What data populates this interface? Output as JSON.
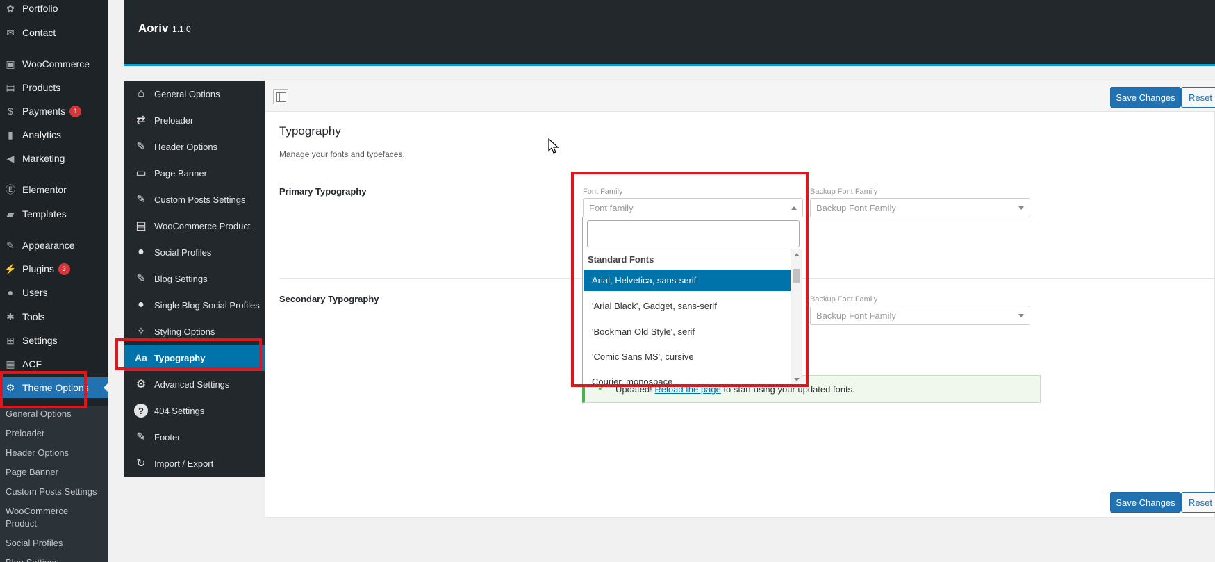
{
  "sidebar": {
    "items": [
      {
        "label": "Portfolio",
        "icon": "portfolio-icon",
        "glyph": "✿"
      },
      {
        "label": "Contact",
        "icon": "mail-icon",
        "glyph": "✉"
      },
      {
        "label": "WooCommerce",
        "icon": "woocommerce-icon",
        "glyph": "▣"
      },
      {
        "label": "Products",
        "icon": "products-icon",
        "glyph": "▤"
      },
      {
        "label": "Payments",
        "icon": "payments-icon",
        "glyph": "$",
        "badge": "1"
      },
      {
        "label": "Analytics",
        "icon": "analytics-icon",
        "glyph": "▮"
      },
      {
        "label": "Marketing",
        "icon": "megaphone-icon",
        "glyph": "◀"
      },
      {
        "label": "Elementor",
        "icon": "elementor-icon",
        "glyph": "Ⓔ"
      },
      {
        "label": "Templates",
        "icon": "folder-icon",
        "glyph": "▰"
      },
      {
        "label": "Appearance",
        "icon": "brush-icon",
        "glyph": "✎"
      },
      {
        "label": "Plugins",
        "icon": "plugin-icon",
        "glyph": "⚡",
        "badge": "3"
      },
      {
        "label": "Users",
        "icon": "user-icon",
        "glyph": "●"
      },
      {
        "label": "Tools",
        "icon": "wrench-icon",
        "glyph": "✱"
      },
      {
        "label": "Settings",
        "icon": "settings-icon",
        "glyph": "⊞"
      },
      {
        "label": "ACF",
        "icon": "acf-icon",
        "glyph": "▦"
      },
      {
        "label": "Theme Options",
        "icon": "gear-icon",
        "glyph": "⚙"
      }
    ],
    "submenu": [
      "General Options",
      "Preloader",
      "Header Options",
      "Page Banner",
      "Custom Posts Settings",
      "WooCommerce Product",
      "Social Profiles",
      "Blog Settings"
    ]
  },
  "header": {
    "title": "Aoriv",
    "version": "1.1.0"
  },
  "nav": {
    "items": [
      {
        "label": "General Options",
        "icon": "home-icon",
        "glyph": "⌂"
      },
      {
        "label": "Preloader",
        "icon": "repeat-icon",
        "glyph": "⇄"
      },
      {
        "label": "Header Options",
        "icon": "edit-icon",
        "glyph": "✎"
      },
      {
        "label": "Page Banner",
        "icon": "banner-icon",
        "glyph": "▭"
      },
      {
        "label": "Custom Posts Settings",
        "icon": "edit-icon",
        "glyph": "✎"
      },
      {
        "label": "WooCommerce Product",
        "icon": "clipboard-icon",
        "glyph": "▤"
      },
      {
        "label": "Social Profiles",
        "icon": "user-icon",
        "glyph": "●"
      },
      {
        "label": "Blog Settings",
        "icon": "edit-icon",
        "glyph": "✎"
      },
      {
        "label": "Single Blog Social Profiles",
        "icon": "user-icon",
        "glyph": "●"
      },
      {
        "label": "Styling Options",
        "icon": "magic-wand-icon",
        "glyph": "✧"
      },
      {
        "label": "Typography",
        "icon": "typography-icon",
        "glyph": "Aa"
      },
      {
        "label": "Advanced Settings",
        "icon": "cogs-icon",
        "glyph": "⚙"
      },
      {
        "label": "404 Settings",
        "icon": "question-icon",
        "glyph": "?"
      },
      {
        "label": "Footer",
        "icon": "edit-icon",
        "glyph": "✎"
      },
      {
        "label": "Import / Export",
        "icon": "refresh-icon",
        "glyph": "↻"
      }
    ]
  },
  "toolbar": {
    "save_label": "Save Changes",
    "reset_label": "Reset Section"
  },
  "section": {
    "title": "Typography",
    "description": "Manage your fonts and typefaces."
  },
  "primary": {
    "label": "Primary Typography",
    "font_family_label": "Font Family",
    "font_family_placeholder": "Font family",
    "backup_label": "Backup Font Family",
    "backup_placeholder": "Backup Font Family"
  },
  "secondary": {
    "label": "Secondary Typography",
    "backup_label": "Backup Font Family",
    "backup_placeholder": "Backup Font Family"
  },
  "dropdown": {
    "search_value": "",
    "group": "Standard Fonts",
    "options": [
      "Arial, Helvetica, sans-serif",
      "'Arial Black', Gadget, sans-serif",
      "'Bookman Old Style', serif",
      "'Comic Sans MS', cursive",
      "Courier, monospace"
    ]
  },
  "notice": {
    "prefix": "Updated!",
    "link": "Reload the page",
    "suffix": "to start using your updated fonts."
  },
  "colors": {
    "accent": "#0073aa",
    "wp_active": "#2271b1",
    "annotation": "#e3141b",
    "success": "#46b450"
  }
}
